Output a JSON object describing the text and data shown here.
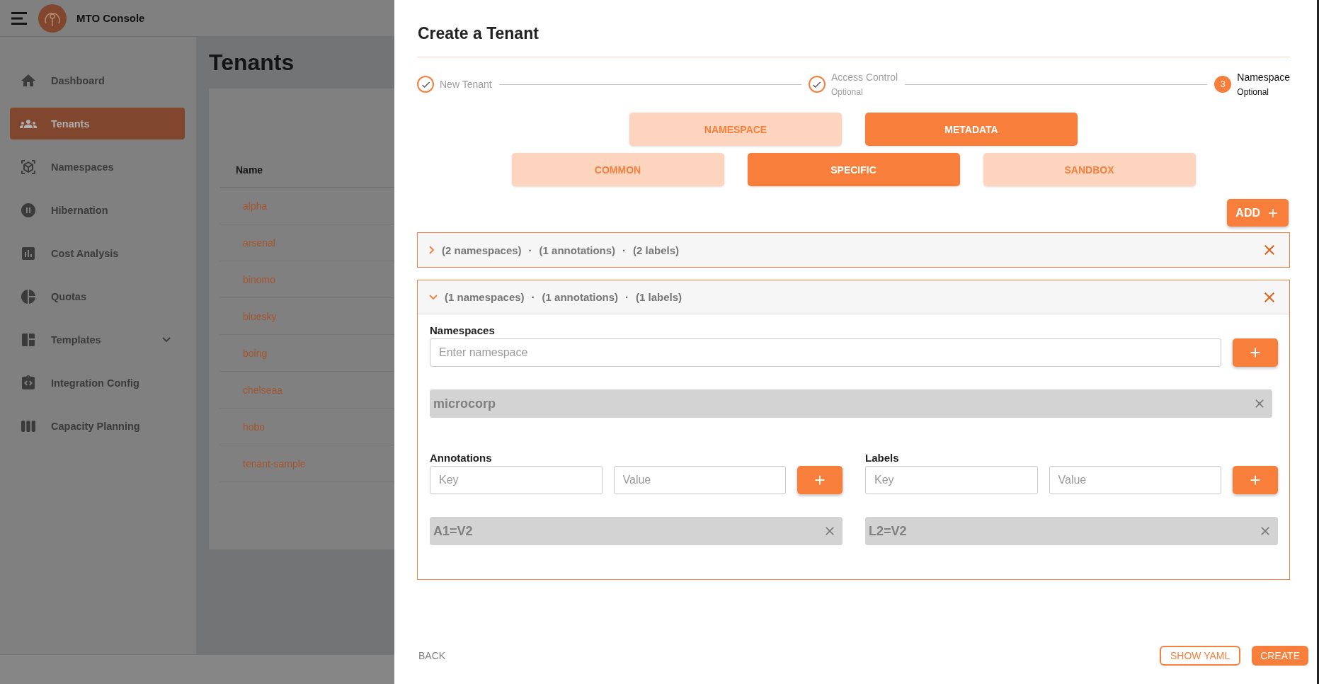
{
  "app": {
    "title": "MTO Console"
  },
  "sidebar": {
    "items": [
      {
        "label": "Dashboard",
        "selected": false
      },
      {
        "label": "Tenants",
        "selected": true
      },
      {
        "label": "Namespaces",
        "selected": false
      },
      {
        "label": "Hibernation",
        "selected": false
      },
      {
        "label": "Cost Analysis",
        "selected": false
      },
      {
        "label": "Quotas",
        "selected": false
      },
      {
        "label": "Templates",
        "selected": false,
        "expanded": false
      },
      {
        "label": "Integration Config",
        "selected": false
      },
      {
        "label": "Capacity Planning",
        "selected": false
      }
    ]
  },
  "page": {
    "title": "Tenants",
    "table": {
      "columns": [
        "Name"
      ],
      "rows": [
        "alpha",
        "arsenal",
        "binomo",
        "bluesky",
        "boing",
        "chelseaa",
        "hobo",
        "tenant-sample"
      ]
    }
  },
  "drawer": {
    "title": "Create a Tenant",
    "steps": [
      {
        "label": "New Tenant",
        "completed": true,
        "active": false
      },
      {
        "label": "Access Control",
        "subtitle": "Optional",
        "completed": true,
        "active": false
      },
      {
        "label": "Namespace",
        "subtitle": "Optional",
        "number": "3",
        "completed": false,
        "active": true
      }
    ],
    "tab_rows": [
      [
        {
          "label": "NAMESPACE",
          "selected": false
        },
        {
          "label": "METADATA",
          "selected": true
        }
      ],
      [
        {
          "label": "COMMON",
          "selected": false
        },
        {
          "label": "SPECIFIC",
          "selected": true
        },
        {
          "label": "SANDBOX",
          "selected": false
        }
      ]
    ],
    "add_button": "ADD",
    "groups": [
      {
        "expanded": false,
        "separator": "·",
        "summary": [
          "(2 namespaces)",
          "(1 annotations)",
          "(2 labels)"
        ]
      },
      {
        "expanded": true,
        "separator": "·",
        "summary": [
          "(1 namespaces)",
          "(1 annotations)",
          "(1 labels)"
        ],
        "namespaces": {
          "label": "Namespaces",
          "placeholder": "Enter namespace",
          "chips": [
            "microcorp"
          ]
        },
        "pairs": [
          {
            "label": "Annotations",
            "key_placeholder": "Key",
            "value_placeholder": "Value",
            "chips": [
              "A1=V2"
            ]
          },
          {
            "label": "Labels",
            "key_placeholder": "Key",
            "value_placeholder": "Value",
            "chips": [
              "L2=V2"
            ]
          }
        ]
      }
    ],
    "footer": {
      "back": "BACK",
      "show_yaml": "SHOW YAML",
      "create": "CREATE"
    }
  }
}
